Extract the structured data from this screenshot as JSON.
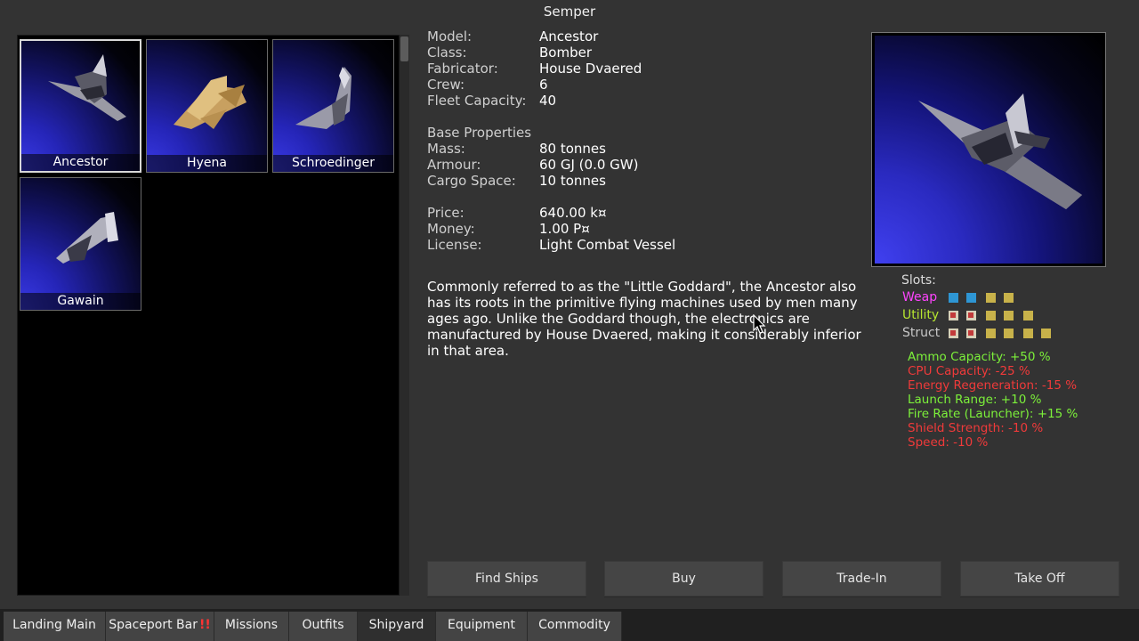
{
  "window": {
    "title": "Semper"
  },
  "ships": [
    {
      "name": "Ancestor",
      "selected": true
    },
    {
      "name": "Hyena",
      "selected": false
    },
    {
      "name": "Schroedinger",
      "selected": false
    },
    {
      "name": "Gawain",
      "selected": false
    }
  ],
  "details": {
    "model_label": "Model:",
    "model": "Ancestor",
    "class_label": "Class:",
    "class": "Bomber",
    "fabricator_label": "Fabricator:",
    "fabricator": "House Dvaered",
    "crew_label": "Crew:",
    "crew": "6",
    "fleet_label": "Fleet Capacity:",
    "fleet": "40",
    "base_heading": "Base Properties",
    "mass_label": "Mass:",
    "mass": "80 tonnes",
    "armour_label": "Armour:",
    "armour": "60 GJ (0.0 GW)",
    "cargo_label": "Cargo Space:",
    "cargo": "10 tonnes",
    "price_label": "Price:",
    "price": "640.00 k¤",
    "money_label": "Money:",
    "money": "1.00 P¤",
    "license_label": "License:",
    "license": "Light Combat Vessel"
  },
  "description": "Commonly referred to as the \"Little Goddard\", the Ancestor also has its roots in the primitive flying machines used by men many ages ago. Unlike the Goddard though, the electronics are manufactured by House Dvaered, making it considerably inferior in that area.",
  "slots": {
    "title": "Slots:",
    "weap_label": "Weap",
    "utility_label": "Utility",
    "struct_label": "Struct",
    "colors": {
      "weap": "#ff44ff",
      "utility": "#b6e630",
      "struct": "#c8c8c8"
    }
  },
  "stats": [
    {
      "text": "Ammo Capacity: +50 %",
      "good": true
    },
    {
      "text": "CPU Capacity: -25 %",
      "good": false
    },
    {
      "text": "Energy Regeneration: -15 %",
      "good": false
    },
    {
      "text": "Launch Range: +10 %",
      "good": true
    },
    {
      "text": "Fire Rate (Launcher): +15 %",
      "good": true
    },
    {
      "text": "Shield Strength: -10 %",
      "good": false
    },
    {
      "text": "Speed: -10 %",
      "good": false
    }
  ],
  "buttons": {
    "find_ships": "Find Ships",
    "buy": "Buy",
    "trade_in": "Trade-In",
    "take_off": "Take Off"
  },
  "tabs": [
    {
      "label": "Landing Main",
      "active": false
    },
    {
      "label": "Spaceport Bar",
      "active": false,
      "alert": "!!"
    },
    {
      "label": "Missions",
      "active": false
    },
    {
      "label": "Outfits",
      "active": false
    },
    {
      "label": "Shipyard",
      "active": true
    },
    {
      "label": "Equipment",
      "active": false
    },
    {
      "label": "Commodity",
      "active": false
    }
  ]
}
